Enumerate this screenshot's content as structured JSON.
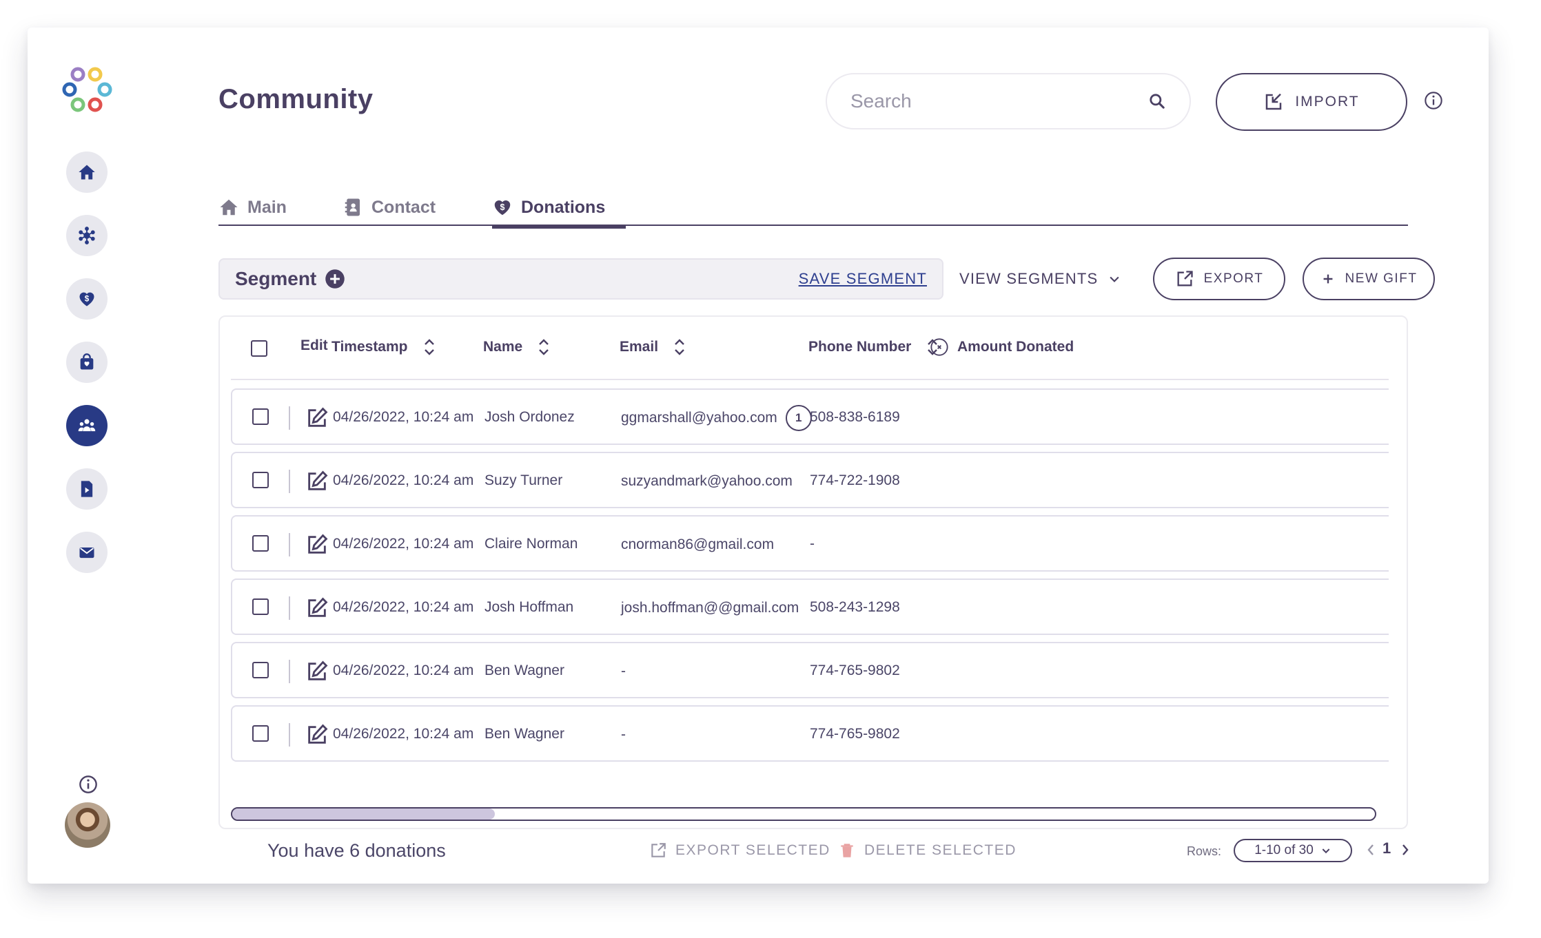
{
  "app": {
    "title": "Community",
    "colors": {
      "primary": "#4a4063",
      "nav_active": "#283a85",
      "link": "#2e3f8f",
      "muted": "#9a97a8",
      "delete_icon": "#e9a3a3"
    }
  },
  "sidebar": {
    "items": [
      {
        "name": "home",
        "icon": "home-icon",
        "active": false
      },
      {
        "name": "network",
        "icon": "network-icon",
        "active": false
      },
      {
        "name": "donations",
        "icon": "heart-dollar-icon",
        "active": false
      },
      {
        "name": "store",
        "icon": "shopping-bag-icon",
        "active": false
      },
      {
        "name": "community",
        "icon": "people-icon",
        "active": true
      },
      {
        "name": "documents",
        "icon": "document-play-icon",
        "active": false
      },
      {
        "name": "mail",
        "icon": "mail-icon",
        "active": false
      }
    ]
  },
  "header": {
    "search_placeholder": "Search",
    "import_label": "IMPORT"
  },
  "tabs": [
    {
      "label": "Main",
      "icon": "home-icon",
      "active": false
    },
    {
      "label": "Contact",
      "icon": "contact-book-icon",
      "active": false
    },
    {
      "label": "Donations",
      "icon": "heart-dollar-icon",
      "active": true
    }
  ],
  "toolbar": {
    "segment_label": "Segment",
    "save_segment": "SAVE SEGMENT",
    "view_segments": "VIEW SEGMENTS",
    "export_label": "EXPORT",
    "new_gift_label": "NEW GIFT"
  },
  "table": {
    "columns": {
      "edit": "Edit",
      "timestamp": "Timestamp",
      "name": "Name",
      "email": "Email",
      "phone": "Phone Number",
      "amount": "Amount Donated"
    },
    "rows": [
      {
        "timestamp": "04/26/2022, 10:24 am",
        "name": "Josh Ordonez",
        "email": "ggmarshall@yahoo.com",
        "email_badge": "1",
        "phone": "508-838-6189"
      },
      {
        "timestamp": "04/26/2022, 10:24 am",
        "name": "Suzy Turner",
        "email": "suzyandmark@yahoo.com",
        "email_badge": "",
        "phone": "774-722-1908"
      },
      {
        "timestamp": "04/26/2022, 10:24 am",
        "name": "Claire Norman",
        "email": "cnorman86@gmail.com",
        "email_badge": "",
        "phone": "-"
      },
      {
        "timestamp": "04/26/2022, 10:24 am",
        "name": "Josh Hoffman",
        "email": "josh.hoffman@@gmail.com",
        "email_badge": "",
        "phone": "508-243-1298"
      },
      {
        "timestamp": "04/26/2022, 10:24 am",
        "name": "Ben Wagner",
        "email": "-",
        "email_badge": "",
        "phone": "774-765-9802"
      },
      {
        "timestamp": "04/26/2022, 10:24 am",
        "name": "Ben Wagner",
        "email": "-",
        "email_badge": "",
        "phone": "774-765-9802"
      }
    ],
    "scroll_position": 0.23
  },
  "footer": {
    "summary": "You have 6 donations",
    "export_selected": "EXPORT SELECTED",
    "delete_selected": "DELETE SELECTED",
    "rows_label": "Rows:",
    "rows_value": "1-10 of 30",
    "page": "1"
  }
}
